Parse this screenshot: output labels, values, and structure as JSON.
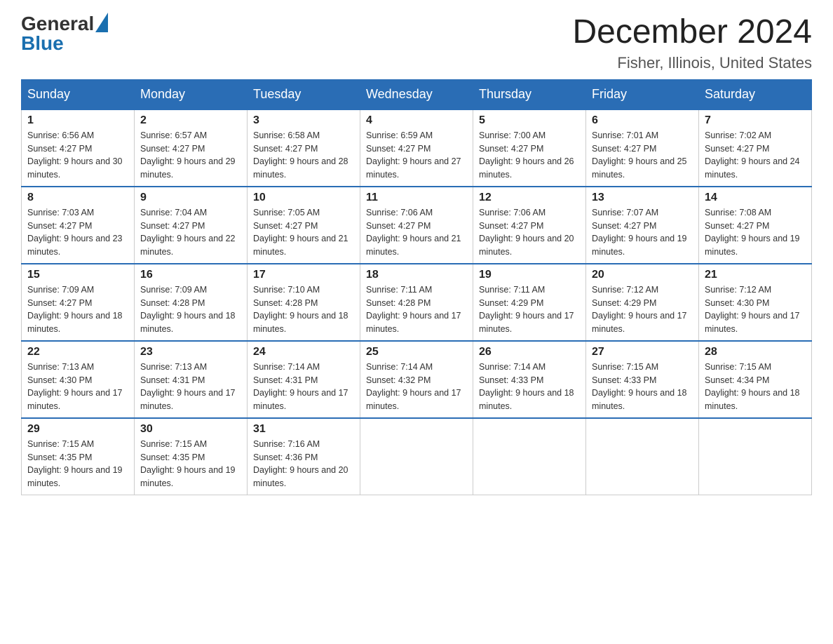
{
  "logo": {
    "general": "General",
    "blue": "Blue"
  },
  "header": {
    "month_year": "December 2024",
    "location": "Fisher, Illinois, United States"
  },
  "weekdays": [
    "Sunday",
    "Monday",
    "Tuesday",
    "Wednesday",
    "Thursday",
    "Friday",
    "Saturday"
  ],
  "weeks": [
    [
      {
        "day": "1",
        "sunrise": "6:56 AM",
        "sunset": "4:27 PM",
        "daylight": "9 hours and 30 minutes."
      },
      {
        "day": "2",
        "sunrise": "6:57 AM",
        "sunset": "4:27 PM",
        "daylight": "9 hours and 29 minutes."
      },
      {
        "day": "3",
        "sunrise": "6:58 AM",
        "sunset": "4:27 PM",
        "daylight": "9 hours and 28 minutes."
      },
      {
        "day": "4",
        "sunrise": "6:59 AM",
        "sunset": "4:27 PM",
        "daylight": "9 hours and 27 minutes."
      },
      {
        "day": "5",
        "sunrise": "7:00 AM",
        "sunset": "4:27 PM",
        "daylight": "9 hours and 26 minutes."
      },
      {
        "day": "6",
        "sunrise": "7:01 AM",
        "sunset": "4:27 PM",
        "daylight": "9 hours and 25 minutes."
      },
      {
        "day": "7",
        "sunrise": "7:02 AM",
        "sunset": "4:27 PM",
        "daylight": "9 hours and 24 minutes."
      }
    ],
    [
      {
        "day": "8",
        "sunrise": "7:03 AM",
        "sunset": "4:27 PM",
        "daylight": "9 hours and 23 minutes."
      },
      {
        "day": "9",
        "sunrise": "7:04 AM",
        "sunset": "4:27 PM",
        "daylight": "9 hours and 22 minutes."
      },
      {
        "day": "10",
        "sunrise": "7:05 AM",
        "sunset": "4:27 PM",
        "daylight": "9 hours and 21 minutes."
      },
      {
        "day": "11",
        "sunrise": "7:06 AM",
        "sunset": "4:27 PM",
        "daylight": "9 hours and 21 minutes."
      },
      {
        "day": "12",
        "sunrise": "7:06 AM",
        "sunset": "4:27 PM",
        "daylight": "9 hours and 20 minutes."
      },
      {
        "day": "13",
        "sunrise": "7:07 AM",
        "sunset": "4:27 PM",
        "daylight": "9 hours and 19 minutes."
      },
      {
        "day": "14",
        "sunrise": "7:08 AM",
        "sunset": "4:27 PM",
        "daylight": "9 hours and 19 minutes."
      }
    ],
    [
      {
        "day": "15",
        "sunrise": "7:09 AM",
        "sunset": "4:27 PM",
        "daylight": "9 hours and 18 minutes."
      },
      {
        "day": "16",
        "sunrise": "7:09 AM",
        "sunset": "4:28 PM",
        "daylight": "9 hours and 18 minutes."
      },
      {
        "day": "17",
        "sunrise": "7:10 AM",
        "sunset": "4:28 PM",
        "daylight": "9 hours and 18 minutes."
      },
      {
        "day": "18",
        "sunrise": "7:11 AM",
        "sunset": "4:28 PM",
        "daylight": "9 hours and 17 minutes."
      },
      {
        "day": "19",
        "sunrise": "7:11 AM",
        "sunset": "4:29 PM",
        "daylight": "9 hours and 17 minutes."
      },
      {
        "day": "20",
        "sunrise": "7:12 AM",
        "sunset": "4:29 PM",
        "daylight": "9 hours and 17 minutes."
      },
      {
        "day": "21",
        "sunrise": "7:12 AM",
        "sunset": "4:30 PM",
        "daylight": "9 hours and 17 minutes."
      }
    ],
    [
      {
        "day": "22",
        "sunrise": "7:13 AM",
        "sunset": "4:30 PM",
        "daylight": "9 hours and 17 minutes."
      },
      {
        "day": "23",
        "sunrise": "7:13 AM",
        "sunset": "4:31 PM",
        "daylight": "9 hours and 17 minutes."
      },
      {
        "day": "24",
        "sunrise": "7:14 AM",
        "sunset": "4:31 PM",
        "daylight": "9 hours and 17 minutes."
      },
      {
        "day": "25",
        "sunrise": "7:14 AM",
        "sunset": "4:32 PM",
        "daylight": "9 hours and 17 minutes."
      },
      {
        "day": "26",
        "sunrise": "7:14 AM",
        "sunset": "4:33 PM",
        "daylight": "9 hours and 18 minutes."
      },
      {
        "day": "27",
        "sunrise": "7:15 AM",
        "sunset": "4:33 PM",
        "daylight": "9 hours and 18 minutes."
      },
      {
        "day": "28",
        "sunrise": "7:15 AM",
        "sunset": "4:34 PM",
        "daylight": "9 hours and 18 minutes."
      }
    ],
    [
      {
        "day": "29",
        "sunrise": "7:15 AM",
        "sunset": "4:35 PM",
        "daylight": "9 hours and 19 minutes."
      },
      {
        "day": "30",
        "sunrise": "7:15 AM",
        "sunset": "4:35 PM",
        "daylight": "9 hours and 19 minutes."
      },
      {
        "day": "31",
        "sunrise": "7:16 AM",
        "sunset": "4:36 PM",
        "daylight": "9 hours and 20 minutes."
      },
      null,
      null,
      null,
      null
    ]
  ],
  "labels": {
    "sunrise": "Sunrise: ",
    "sunset": "Sunset: ",
    "daylight": "Daylight: "
  }
}
